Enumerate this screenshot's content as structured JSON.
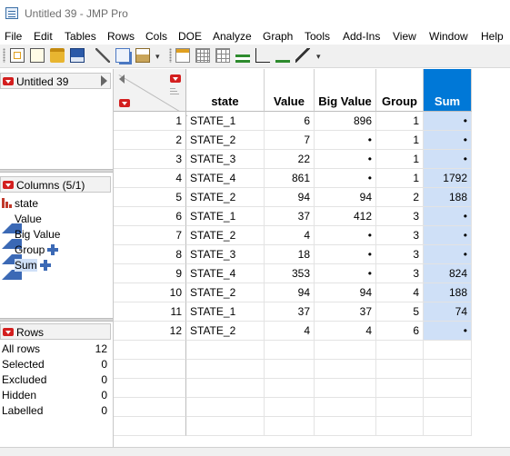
{
  "window": {
    "title": "Untitled 39 - JMP Pro"
  },
  "menu": [
    "File",
    "Edit",
    "Tables",
    "Rows",
    "Cols",
    "DOE",
    "Analyze",
    "Graph",
    "Tools",
    "Add-Ins",
    "View",
    "Window",
    "Help"
  ],
  "toolbar": {
    "group1": [
      "new-data-table-icon",
      "new-script-icon",
      "open-folder-icon",
      "save-icon",
      "cut-icon",
      "copy-icon",
      "paste-icon"
    ],
    "group2": [
      "data-table-icon",
      "calculator-icon",
      "grid-icon",
      "distribution-icon",
      "fit-y-by-x-icon",
      "fit-model-icon",
      "script-edit-icon"
    ],
    "more_glyph": "▾"
  },
  "table_panel": {
    "name": "Untitled 39"
  },
  "columns_panel": {
    "header": "Columns (5/1)",
    "items": [
      {
        "name": "state",
        "type": "nominal",
        "plus": false,
        "selected": false
      },
      {
        "name": "Value",
        "type": "continuous",
        "plus": false,
        "selected": false
      },
      {
        "name": "Big Value",
        "type": "continuous",
        "plus": false,
        "selected": false
      },
      {
        "name": "Group",
        "type": "continuous",
        "plus": true,
        "selected": false
      },
      {
        "name": "Sum",
        "type": "continuous",
        "plus": true,
        "selected": true
      }
    ]
  },
  "rows_panel": {
    "header": "Rows",
    "items": [
      {
        "label": "All rows",
        "value": "12"
      },
      {
        "label": "Selected",
        "value": "0"
      },
      {
        "label": "Excluded",
        "value": "0"
      },
      {
        "label": "Hidden",
        "value": "0"
      },
      {
        "label": "Labelled",
        "value": "0"
      }
    ]
  },
  "grid": {
    "columns": [
      "state",
      "Value",
      "Big Value",
      "Group",
      "Sum"
    ],
    "selected_column": "Sum",
    "rows": [
      [
        "1",
        "STATE_1",
        "6",
        "896",
        "1",
        "•"
      ],
      [
        "2",
        "STATE_2",
        "7",
        "•",
        "1",
        "•"
      ],
      [
        "3",
        "STATE_3",
        "22",
        "•",
        "1",
        "•"
      ],
      [
        "4",
        "STATE_4",
        "861",
        "•",
        "1",
        "1792"
      ],
      [
        "5",
        "STATE_2",
        "94",
        "94",
        "2",
        "188"
      ],
      [
        "6",
        "STATE_1",
        "37",
        "412",
        "3",
        "•"
      ],
      [
        "7",
        "STATE_2",
        "4",
        "•",
        "3",
        "•"
      ],
      [
        "8",
        "STATE_3",
        "18",
        "•",
        "3",
        "•"
      ],
      [
        "9",
        "STATE_4",
        "353",
        "•",
        "3",
        "824"
      ],
      [
        "10",
        "STATE_2",
        "94",
        "94",
        "4",
        "188"
      ],
      [
        "11",
        "STATE_1",
        "37",
        "37",
        "5",
        "74"
      ],
      [
        "12",
        "STATE_2",
        "4",
        "4",
        "6",
        "•"
      ]
    ]
  }
}
